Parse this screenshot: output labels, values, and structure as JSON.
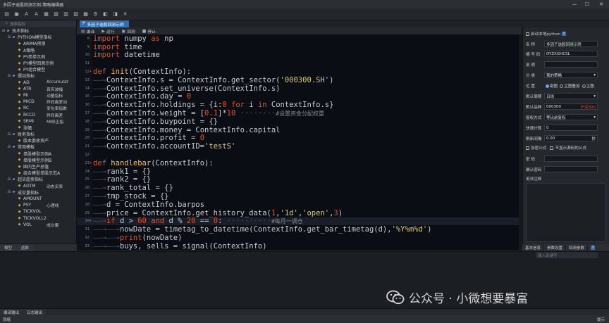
{
  "window": {
    "title": "多因子选股回测示例-策略编辑器"
  },
  "toolbar": {
    "icons": [
      "new-icon",
      "open-icon",
      "font-increase-icon",
      "font-decrease-icon",
      "save-icon",
      "save-as-icon",
      "export-icon",
      "import-icon",
      "print-icon",
      "settings-icon",
      "info-icon",
      "help-icon",
      "close-icon"
    ]
  },
  "left_panel": {
    "search_placeholder": "搜索指标",
    "tree": [
      {
        "level": 0,
        "type": "folder",
        "expand": "⊟",
        "label": "技术指标",
        "desc": ""
      },
      {
        "level": 1,
        "type": "folder",
        "expand": "⊟",
        "label": "PYTHON模型指标",
        "desc": ""
      },
      {
        "level": 2,
        "type": "file",
        "expand": "",
        "label": "ARIMA预测",
        "desc": ""
      },
      {
        "level": 2,
        "type": "file",
        "expand": "",
        "label": "A策略",
        "desc": ""
      },
      {
        "level": 2,
        "type": "file",
        "expand": "",
        "label": "PY简单示例",
        "desc": ""
      },
      {
        "level": 2,
        "type": "file",
        "expand": "",
        "label": "PY模型回测示例",
        "desc": ""
      },
      {
        "level": 2,
        "type": "file",
        "expand": "",
        "label": "PY组合模型",
        "desc": ""
      },
      {
        "level": 1,
        "type": "folder",
        "expand": "⊟",
        "label": "摆动指标",
        "desc": ""
      },
      {
        "level": 2,
        "type": "file",
        "expand": "",
        "label": "AD",
        "desc": "Accumulat"
      },
      {
        "level": 2,
        "type": "file",
        "expand": "",
        "label": "ATR",
        "desc": "真实波幅"
      },
      {
        "level": 2,
        "type": "file",
        "expand": "",
        "label": "MI",
        "desc": "动量指标"
      },
      {
        "level": 2,
        "type": "file",
        "expand": "",
        "label": "MICD",
        "desc": "异同离差动"
      },
      {
        "level": 2,
        "type": "file",
        "expand": "",
        "label": "RC",
        "desc": "变化率指数"
      },
      {
        "level": 2,
        "type": "file",
        "expand": "",
        "label": "RCCD",
        "desc": "异同离差"
      },
      {
        "level": 2,
        "type": "file",
        "expand": "",
        "label": "SRMI",
        "desc": "MI修正指"
      },
      {
        "level": 2,
        "type": "file",
        "expand": "",
        "label": "涨幅",
        "desc": ""
      },
      {
        "level": 1,
        "type": "folder",
        "expand": "⊟",
        "label": "财务指标",
        "desc": ""
      },
      {
        "level": 2,
        "type": "file",
        "expand": "",
        "label": "股本委收资产",
        "desc": ""
      },
      {
        "level": 1,
        "type": "folder",
        "expand": "⊟",
        "label": "常用模板",
        "desc": ""
      },
      {
        "level": 2,
        "type": "file",
        "expand": "",
        "label": "单股模型示例A",
        "desc": ""
      },
      {
        "level": 2,
        "type": "file",
        "expand": "",
        "label": "单股模型示例B",
        "desc": ""
      },
      {
        "level": 2,
        "type": "file",
        "expand": "",
        "label": "国内生产总值",
        "desc": ""
      },
      {
        "level": 2,
        "type": "file",
        "expand": "",
        "label": "组合模型单股示范A",
        "desc": ""
      },
      {
        "level": 1,
        "type": "folder",
        "expand": "⊟",
        "label": "超买超卖指标",
        "desc": ""
      },
      {
        "level": 2,
        "type": "file",
        "expand": "",
        "label": "ADTM",
        "desc": "动态买卖"
      },
      {
        "level": 1,
        "type": "folder",
        "expand": "⊟",
        "label": "成交量指标",
        "desc": ""
      },
      {
        "level": 2,
        "type": "file",
        "expand": "",
        "label": "AMOUNT",
        "desc": ""
      },
      {
        "level": 2,
        "type": "file",
        "expand": "",
        "label": "PSY",
        "desc": "心理线"
      },
      {
        "level": 2,
        "type": "file",
        "expand": "",
        "label": "TICKVOL",
        "desc": ""
      },
      {
        "level": 2,
        "type": "file",
        "expand": "",
        "label": "TICKVOLL2",
        "desc": ""
      },
      {
        "level": 2,
        "type": "file",
        "expand": "",
        "label": "VOL",
        "desc": "成交量"
      }
    ],
    "tabs": [
      "模型",
      "函数"
    ]
  },
  "editor": {
    "doc_tab": "多因子选股回测示例",
    "tools": [
      {
        "icon": "compile-icon",
        "label": "编译"
      },
      {
        "icon": "run-icon",
        "label": "运行"
      },
      {
        "icon": "backtest-icon",
        "label": "回测"
      },
      {
        "icon": "stop-icon",
        "label": "停止"
      }
    ],
    "lines": [
      {
        "n": "8",
        "html": "<span class='k'>import</span> numpy <span class='k'>as</span> np"
      },
      {
        "n": "9",
        "html": "<span class='k'>import</span> time"
      },
      {
        "n": "10",
        "html": "<span class='k'>import</span> datetime"
      },
      {
        "n": "11",
        "html": ""
      },
      {
        "n": "12",
        "fold": "▾",
        "html": "<span class='k'>def</span> <span class='f'>init</span>(ContextInfo):"
      },
      {
        "n": "13",
        "html": "<span class='arr'>——→</span>ContextInfo.s = ContextInfo.get_sector(<span class='s'>'000300.SH'</span>)"
      },
      {
        "n": "14",
        "html": "<span class='arr'>——→</span>ContextInfo.set_universe(ContextInfo.s)"
      },
      {
        "n": "15",
        "html": "<span class='arr'>——→</span>ContextInfo.day = <span class='n'>0</span>"
      },
      {
        "n": "16",
        "html": "<span class='arr'>——→</span>ContextInfo.holdings = {i:<span class='n'>0</span> <span class='k'>for</span> i <span class='k'>in</span> ContextInfo.s}"
      },
      {
        "n": "17",
        "html": "<span class='arr'>——→</span>ContextInfo.weight = [<span class='n'>0.1</span>]*<span class='n'>10</span> <span class='arr'>········</span><span class='c'>#设置资金分配权重</span>"
      },
      {
        "n": "18",
        "html": "<span class='arr'>——→</span>ContextInfo.buypoint = {}"
      },
      {
        "n": "19",
        "html": "<span class='arr'>——→</span>ContextInfo.money = ContextInfo.capital"
      },
      {
        "n": "20",
        "html": "<span class='arr'>——→</span>ContextInfo.profit = <span class='n'>0</span>"
      },
      {
        "n": "21",
        "html": "<span class='arr'>——→</span>ContextInfo.accountID=<span class='s'>'testS'</span>"
      },
      {
        "n": "22",
        "html": ""
      },
      {
        "n": "23",
        "fold": "▾",
        "html": "<span class='k'>def</span> <span class='f'>handlebar</span>(ContextInfo):"
      },
      {
        "n": "24",
        "html": "<span class='arr'>——→</span>rank1 = {}"
      },
      {
        "n": "25",
        "html": "<span class='arr'>——→</span>rank2 = {}"
      },
      {
        "n": "26",
        "html": "<span class='arr'>——→</span>rank_total = {}"
      },
      {
        "n": "27",
        "html": "<span class='arr'>——→</span>tmp_stock = {}"
      },
      {
        "n": "28",
        "html": "<span class='arr'>——→</span>d = ContextInfo.barpos"
      },
      {
        "n": "29",
        "html": "<span class='arr'>——→</span>price = ContextInfo.get_history_data(<span class='n'>1</span>,<span class='s'>'1d'</span>,<span class='s'>'open'</span>,<span class='n'>3</span>)"
      },
      {
        "n": "30",
        "fold": "▾",
        "html": "<span class='arr'>——→</span><span class='k'>if</span> d &gt; <span class='n'>60</span> <span class='k'>and</span> d % <span class='n'>20</span> == <span class='n'>0</span>: <span class='arr'>··········</span><span class='c'>#每月一调仓</span>"
      },
      {
        "n": "31",
        "html": "<span class='arr'>——→——→</span>nowDate = timetag_to_datetime(ContextInfo.get_bar_timetag(d),<span class='s'>'%Y%m%d'</span>)"
      },
      {
        "n": "32",
        "html": "<span class='arr'>——→——→</span><span class='k'>print</span>(nowDate)"
      },
      {
        "n": "33",
        "html": "<span class='arr'>——→——→</span>buys, sells = signal(ContextInfo)"
      }
    ]
  },
  "right_panel": {
    "enable_python": "启动本地python",
    "name_label": "名    称",
    "name_value": "多因子选股回测示例",
    "abbr_label": "缩 写 码",
    "abbr_value": "DYZXGHCSL",
    "desc_label": "说    明",
    "category_label": "分    类",
    "category_value": "我的策略",
    "position_label": "位    置",
    "position_options": [
      "副图",
      "主图叠加",
      "主图"
    ],
    "period_label": "默认周期",
    "period_value": "日线",
    "symbol_label": "默认品种",
    "symbol_value": "000300",
    "symbol_code": "沪深300",
    "rights_label": "复权方式",
    "rights_value": "等比前复权",
    "fast_label": "快速计算",
    "fast_value": "0",
    "refresh_label": "刷新间隔",
    "refresh_value": "0.00",
    "refresh_unit": "秒",
    "encrypt_label": "加密公式",
    "hidecode_label": "不显示源码的公式",
    "password_label": "密    码",
    "confirm_label": "确认密码",
    "notes_label": "用法注释",
    "tabs": [
      "基本信息",
      "参数设置",
      "回测参数"
    ]
  },
  "bottom": {
    "search_placeholder": "输入关键字",
    "watermark": "公众号 · 小微想要暴富",
    "tabs": [
      "编译输出",
      "日志输出"
    ]
  },
  "status": {
    "left": "就绪",
    "right": "提示"
  }
}
